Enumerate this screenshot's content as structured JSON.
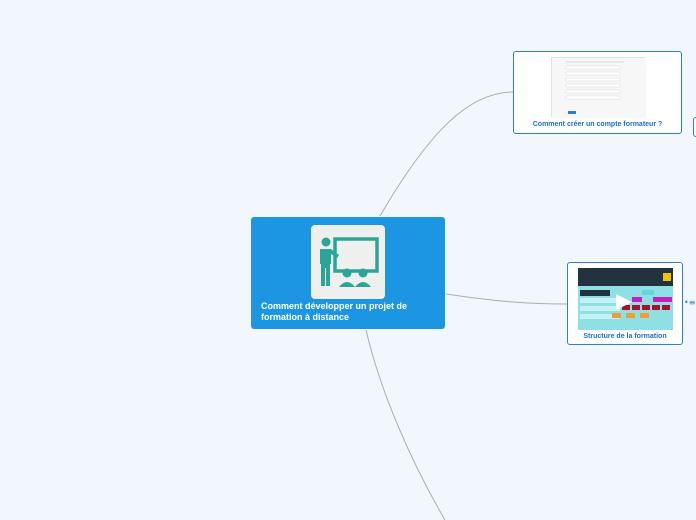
{
  "central": {
    "title": "Comment développer un projet de formation à distance",
    "icon": "teacher-presentation-icon"
  },
  "topics": [
    {
      "label": "Comment créer un compte formateur ?",
      "thumbnail": "form-screenshot-thumbnail"
    },
    {
      "label": "Structure de la formation",
      "thumbnail": "structure-diagram-thumbnail"
    }
  ],
  "colors": {
    "central_bg": "#1c96e3",
    "topic_border": "#2a7fd4",
    "topic_text": "#1e6fbf",
    "connector": "#a9aeb8",
    "background": "#f2f6fd"
  }
}
